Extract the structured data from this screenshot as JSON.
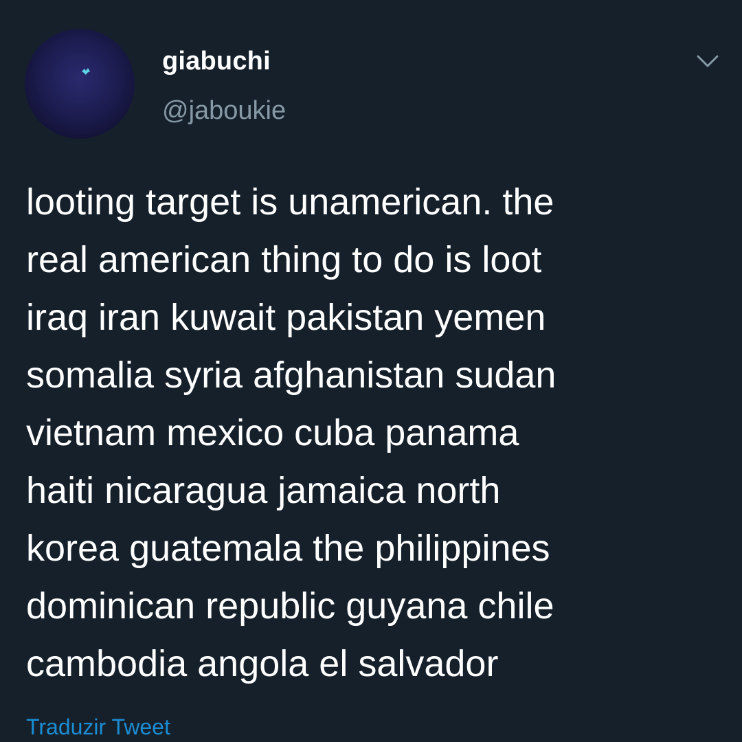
{
  "user": {
    "display_name": "giabuchi",
    "handle": "@jaboukie",
    "avatar_icon": "avatar-image"
  },
  "menu": {
    "icon": "chevron-down-icon"
  },
  "tweet": {
    "text": "looting target is unamerican. the\nreal american thing to do is loot\niraq iran kuwait pakistan yemen\nsomalia syria afghanistan sudan\nvietnam mexico cuba panama\nhaiti nicaragua jamaica north\nkorea guatemala the philippines\ndominican republic guyana chile\ncambodia angola el salvador"
  },
  "actions": {
    "translate_label": "Traduzir Tweet"
  },
  "colors": {
    "background": "#15202b",
    "primary_text": "#ffffff",
    "secondary_text": "#8899a6",
    "link": "#1da1f2"
  }
}
